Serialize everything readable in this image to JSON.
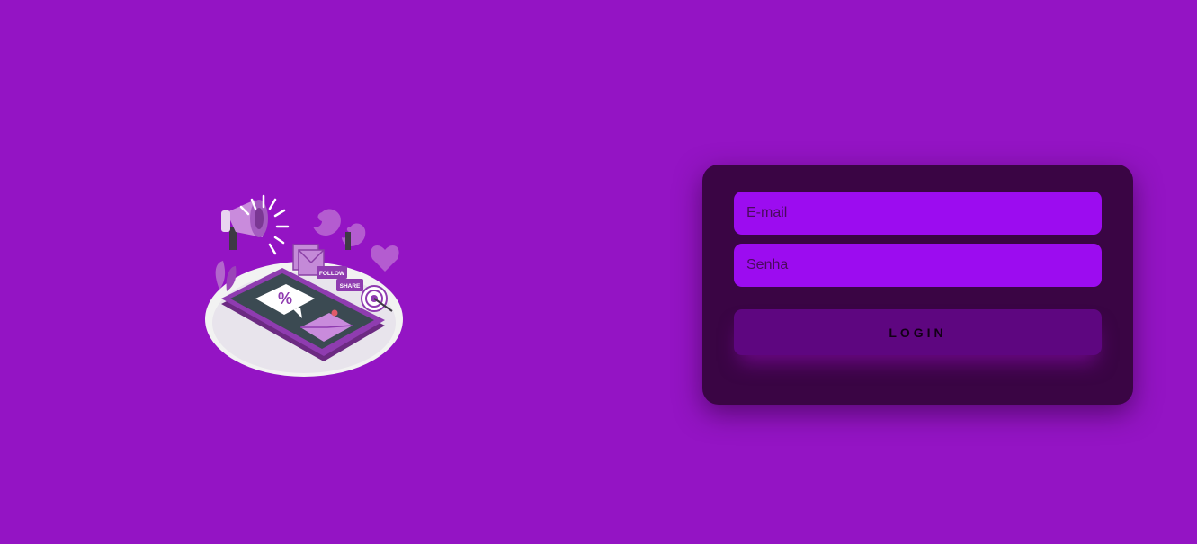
{
  "illustration": {
    "icon": "social-media-marketing-illustration",
    "labels": {
      "percent": "%",
      "follow": "FOLLOW",
      "share": "SHARE"
    }
  },
  "login_form": {
    "email_placeholder": "E-mail",
    "password_placeholder": "Senha",
    "login_label": "LOGIN"
  },
  "colors": {
    "background": "#9414c4",
    "card": "#3a0544",
    "input": "#9c0cf0",
    "button": "#5e0680"
  }
}
